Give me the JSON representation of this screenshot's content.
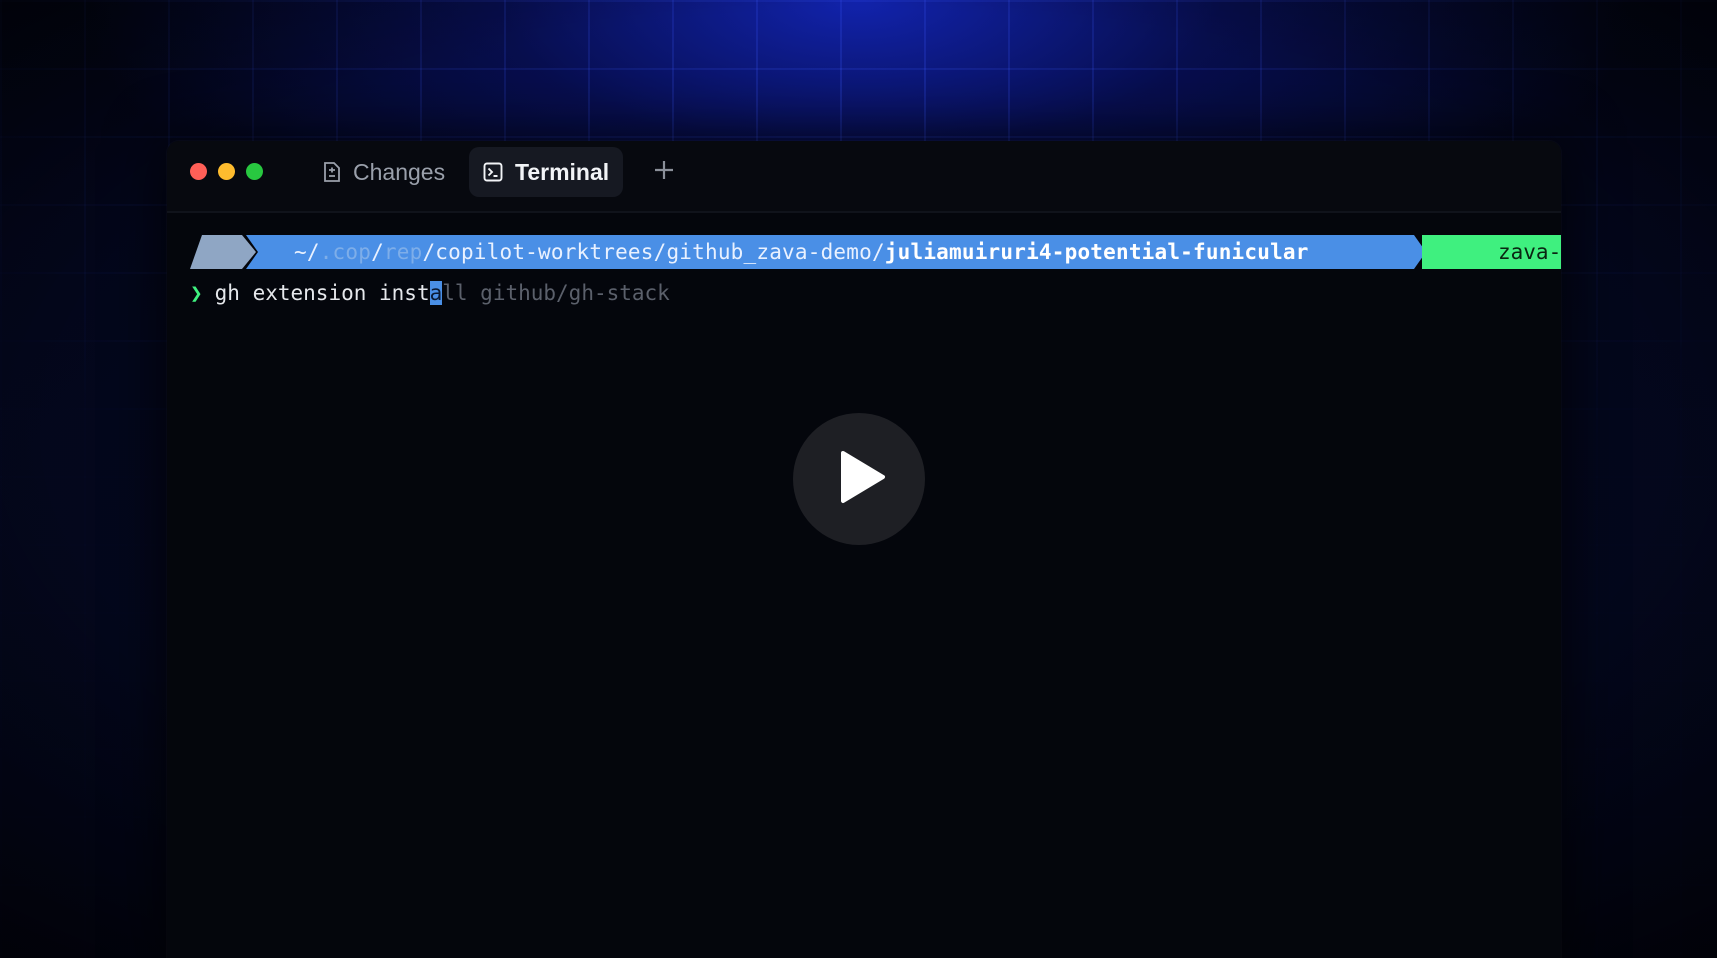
{
  "window": {
    "tabs": [
      {
        "label": "Changes",
        "icon": "file-diff-icon",
        "active": false
      },
      {
        "label": "Terminal",
        "icon": "terminal-icon",
        "active": true
      }
    ],
    "add_tab_icon": "plus-icon"
  },
  "terminal": {
    "prompt": {
      "path_home": "~/",
      "path_dim1": ".cop",
      "path_sep1": "/",
      "path_dim2": "rep",
      "path_mid": "/copilot-worktrees/github_zava-demo/",
      "path_bold": "juliamuiruri4-potential-funicular",
      "git_branch": "zava-rev"
    },
    "command": {
      "chevron": "❯",
      "typed": "gh extension inst",
      "cursor_char": "a",
      "suggestion": "ll github/gh-stack"
    }
  },
  "overlay": {
    "play_icon": "play-icon"
  },
  "colors": {
    "path_segment": "#4a8fe6",
    "git_segment": "#3ff07f",
    "background_glow": "#1428c8"
  }
}
